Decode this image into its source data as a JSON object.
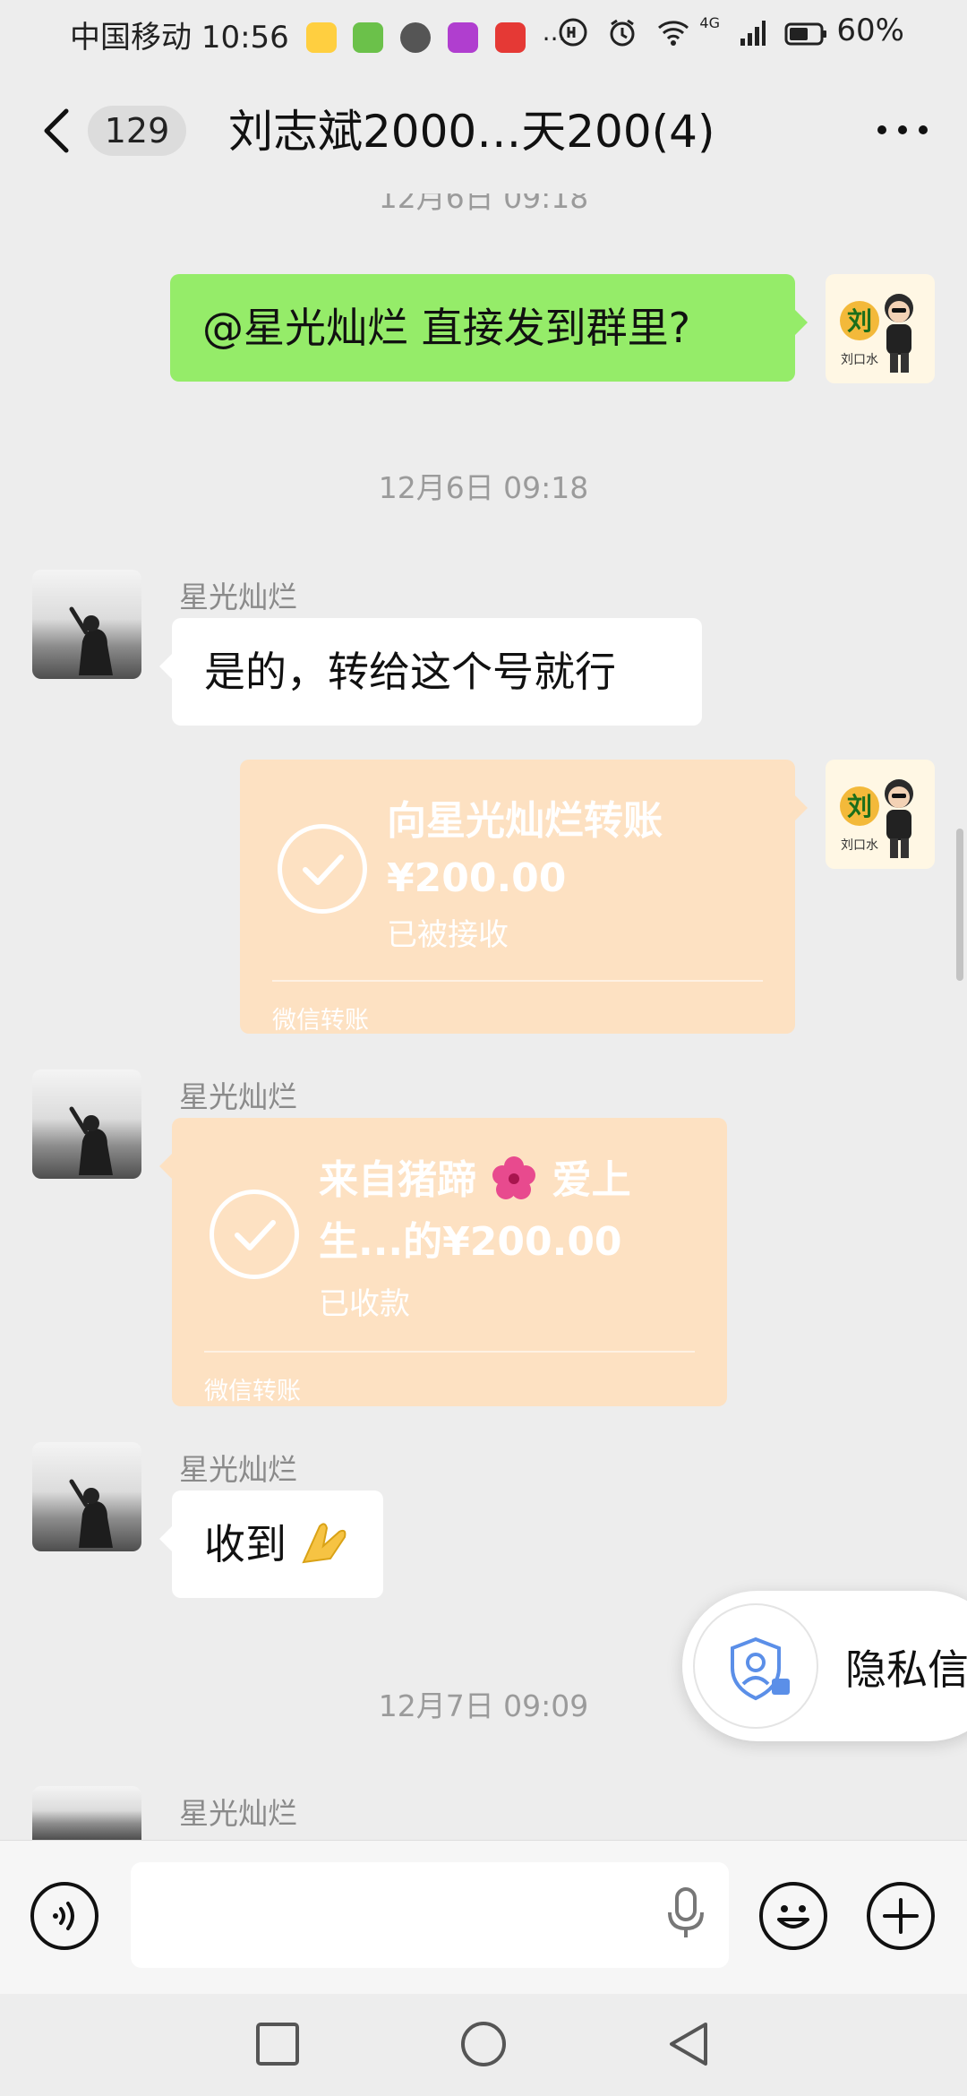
{
  "status_bar": {
    "carrier": "中国移动",
    "time": "10:56",
    "network": "4G",
    "battery": "60%",
    "more_indicator": "···"
  },
  "header": {
    "unread_badge": "129",
    "title": "刘志斌2000…天200(4)"
  },
  "messages": {
    "top_time_partial": "12月6日 09:18",
    "m1_text": "@星光灿烂  直接发到群里?",
    "time_1": "12月6日 09:18",
    "m2_sender": "星光灿烂",
    "m2_text": "是的，转给这个号就行",
    "m3_title": "向星光灿烂转账",
    "m3_amount": "¥200.00",
    "m3_status": "已被接收",
    "m3_footer": "微信转账",
    "m4_sender": "星光灿烂",
    "m4_title_a": "来自猪蹄",
    "m4_title_b": "爱上",
    "m4_title_line2": "生...的¥200.00",
    "m4_status": "已收款",
    "m4_footer": "微信转账",
    "m5_sender": "星光灿烂",
    "m5_text": "收到",
    "time_2": "12月7日 09:09",
    "m6_sender": "星光灿烂"
  },
  "avatar_me": {
    "char": "刘",
    "caption": "刘口水"
  },
  "privacy_prompt": {
    "label": "隐私信"
  },
  "colors": {
    "chat_bg": "#ededed",
    "my_bubble": "#95ec69",
    "other_bubble": "#ffffff",
    "transfer_bubble": "#fde1c2"
  },
  "icons": [
    "back-icon",
    "more-icon",
    "voice-icon",
    "mic-icon",
    "emoji-icon",
    "plus-icon",
    "check-icon",
    "privacy-shield-icon"
  ]
}
